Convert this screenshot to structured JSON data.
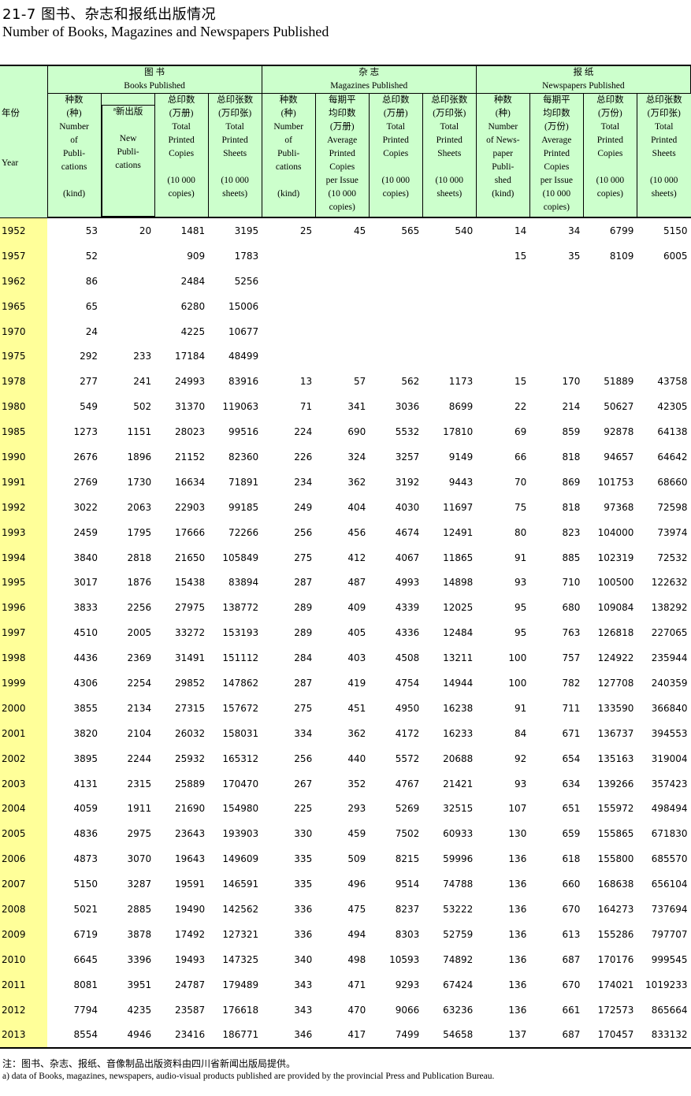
{
  "title_cn": "21-7  图书、杂志和报纸出版情况",
  "title_en": "Number of Books, Magazines and Newspapers Published",
  "year_header": {
    "cn": "年份",
    "en": "Year"
  },
  "groups": [
    {
      "cn": "图  书",
      "en": "Books Published"
    },
    {
      "cn": "杂  志",
      "en": "Magazines Published"
    },
    {
      "cn": "报  纸",
      "en": "Newspapers Published"
    }
  ],
  "columns": [
    {
      "top": "种数",
      "lines": [
        "(种)",
        "Number",
        "of",
        "Publi-",
        "cations",
        "",
        "(kind)"
      ]
    },
    {
      "top": "ª新出版",
      "lines": [
        "New",
        "Publi-",
        "cations"
      ]
    },
    {
      "top": "总印数",
      "lines": [
        "(万册)",
        "Total",
        "Printed",
        "Copies",
        "",
        "(10 000",
        "copies)"
      ]
    },
    {
      "top": "总印张数",
      "lines": [
        "(万印张)",
        "Total",
        "Printed",
        "Sheets",
        "",
        "(10 000",
        "sheets)"
      ]
    },
    {
      "top": "种数",
      "lines": [
        "(种)",
        "Number",
        "of",
        "Publi-",
        "cations",
        "",
        "(kind)"
      ]
    },
    {
      "top": "每期平",
      "lines": [
        "均印数",
        "(万册)",
        "Average",
        "Printed",
        "Copies",
        "per Issue",
        "(10 000",
        "copies)"
      ]
    },
    {
      "top": "总印数",
      "lines": [
        "(万册)",
        "Total",
        "Printed",
        "Copies",
        "",
        "(10 000",
        "copies)"
      ]
    },
    {
      "top": "总印张数",
      "lines": [
        "(万印张)",
        "Total",
        "Printed",
        "Sheets",
        "",
        "(10 000",
        "sheets)"
      ]
    },
    {
      "top": "种数",
      "lines": [
        "(种)",
        "Number",
        "of News-",
        "paper",
        "Publi-",
        "shed",
        "(kind)"
      ]
    },
    {
      "top": "每期平",
      "lines": [
        "均印数",
        "(万份)",
        "Average",
        "Printed",
        "Copies",
        "per Issue",
        "(10 000",
        "copies)"
      ]
    },
    {
      "top": "总印数",
      "lines": [
        "(万份)",
        "Total",
        "Printed",
        "Copies",
        "",
        "(10 000",
        "copies)"
      ]
    },
    {
      "top": "总印张数",
      "lines": [
        "(万印张)",
        "Total",
        "Printed",
        "Sheets",
        "",
        "(10 000",
        "sheets)"
      ]
    }
  ],
  "rows": [
    [
      "1952",
      "53",
      "20",
      "1481",
      "3195",
      "25",
      "45",
      "565",
      "540",
      "14",
      "34",
      "6799",
      "5150"
    ],
    [
      "1957",
      "52",
      "",
      "909",
      "1783",
      "",
      "",
      "",
      "",
      "15",
      "35",
      "8109",
      "6005"
    ],
    [
      "1962",
      "86",
      "",
      "2484",
      "5256",
      "",
      "",
      "",
      "",
      "",
      "",
      "",
      ""
    ],
    [
      "1965",
      "65",
      "",
      "6280",
      "15006",
      "",
      "",
      "",
      "",
      "",
      "",
      "",
      ""
    ],
    [
      "1970",
      "24",
      "",
      "4225",
      "10677",
      "",
      "",
      "",
      "",
      "",
      "",
      "",
      ""
    ],
    [
      "1975",
      "292",
      "233",
      "17184",
      "48499",
      "",
      "",
      "",
      "",
      "",
      "",
      "",
      ""
    ],
    [
      "1978",
      "277",
      "241",
      "24993",
      "83916",
      "13",
      "57",
      "562",
      "1173",
      "15",
      "170",
      "51889",
      "43758"
    ],
    [
      "1980",
      "549",
      "502",
      "31370",
      "119063",
      "71",
      "341",
      "3036",
      "8699",
      "22",
      "214",
      "50627",
      "42305"
    ],
    [
      "1985",
      "1273",
      "1151",
      "28023",
      "99516",
      "224",
      "690",
      "5532",
      "17810",
      "69",
      "859",
      "92878",
      "64138"
    ],
    [
      "1990",
      "2676",
      "1896",
      "21152",
      "82360",
      "226",
      "324",
      "3257",
      "9149",
      "66",
      "818",
      "94657",
      "64642"
    ],
    [
      "1991",
      "2769",
      "1730",
      "16634",
      "71891",
      "234",
      "362",
      "3192",
      "9443",
      "70",
      "869",
      "101753",
      "68660"
    ],
    [
      "1992",
      "3022",
      "2063",
      "22903",
      "99185",
      "249",
      "404",
      "4030",
      "11697",
      "75",
      "818",
      "97368",
      "72598"
    ],
    [
      "1993",
      "2459",
      "1795",
      "17666",
      "72266",
      "256",
      "456",
      "4674",
      "12491",
      "80",
      "823",
      "104000",
      "73974"
    ],
    [
      "1994",
      "3840",
      "2818",
      "21650",
      "105849",
      "275",
      "412",
      "4067",
      "11865",
      "91",
      "885",
      "102319",
      "72532"
    ],
    [
      "1995",
      "3017",
      "1876",
      "15438",
      "83894",
      "287",
      "487",
      "4993",
      "14898",
      "93",
      "710",
      "100500",
      "122632"
    ],
    [
      "1996",
      "3833",
      "2256",
      "27975",
      "138772",
      "289",
      "409",
      "4339",
      "12025",
      "95",
      "680",
      "109084",
      "138292"
    ],
    [
      "1997",
      "4510",
      "2005",
      "33272",
      "153193",
      "289",
      "405",
      "4336",
      "12484",
      "95",
      "763",
      "126818",
      "227065"
    ],
    [
      "1998",
      "4436",
      "2369",
      "31491",
      "151112",
      "284",
      "403",
      "4508",
      "13211",
      "100",
      "757",
      "124922",
      "235944"
    ],
    [
      "1999",
      "4306",
      "2254",
      "29852",
      "147862",
      "287",
      "419",
      "4754",
      "14944",
      "100",
      "782",
      "127708",
      "240359"
    ],
    [
      "2000",
      "3855",
      "2134",
      "27315",
      "157672",
      "275",
      "451",
      "4950",
      "16238",
      "91",
      "711",
      "133590",
      "366840"
    ],
    [
      "2001",
      "3820",
      "2104",
      "26032",
      "158031",
      "334",
      "362",
      "4172",
      "16233",
      "84",
      "671",
      "136737",
      "394553"
    ],
    [
      "2002",
      "3895",
      "2244",
      "25932",
      "165312",
      "256",
      "440",
      "5572",
      "20688",
      "92",
      "654",
      "135163",
      "319004"
    ],
    [
      "2003",
      "4131",
      "2315",
      "25889",
      "170470",
      "267",
      "352",
      "4767",
      "21421",
      "93",
      "634",
      "139266",
      "357423"
    ],
    [
      "2004",
      "4059",
      "1911",
      "21690",
      "154980",
      "225",
      "293",
      "5269",
      "32515",
      "107",
      "651",
      "155972",
      "498494"
    ],
    [
      "2005",
      "4836",
      "2975",
      "23643",
      "193903",
      "330",
      "459",
      "7502",
      "60933",
      "130",
      "659",
      "155865",
      "671830"
    ],
    [
      "2006",
      "4873",
      "3070",
      "19643",
      "149609",
      "335",
      "509",
      "8215",
      "59996",
      "136",
      "618",
      "155800",
      "685570"
    ],
    [
      "2007",
      "5150",
      "3287",
      "19591",
      "146591",
      "335",
      "496",
      "9514",
      "74788",
      "136",
      "660",
      "168638",
      "656104"
    ],
    [
      "2008",
      "5021",
      "2885",
      "19490",
      "142562",
      "336",
      "475",
      "8237",
      "53222",
      "136",
      "670",
      "164273",
      "737694"
    ],
    [
      "2009",
      "6719",
      "3878",
      "17492",
      "127321",
      "336",
      "494",
      "8303",
      "52759",
      "136",
      "613",
      "155286",
      "797707"
    ],
    [
      "2010",
      "6645",
      "3396",
      "19493",
      "147325",
      "340",
      "498",
      "10593",
      "74892",
      "136",
      "687",
      "170176",
      "999545"
    ],
    [
      "2011",
      "8081",
      "3951",
      "24787",
      "179489",
      "343",
      "471",
      "9293",
      "67424",
      "136",
      "670",
      "174021",
      "1019233"
    ],
    [
      "2012",
      "7794",
      "4235",
      "23587",
      "176618",
      "343",
      "470",
      "9066",
      "63236",
      "136",
      "661",
      "172573",
      "865664"
    ],
    [
      "2013",
      "8554",
      "4946",
      "23416",
      "186771",
      "346",
      "417",
      "7499",
      "54658",
      "137",
      "687",
      "170457",
      "833132"
    ]
  ],
  "footnote_cn": "注：图书、杂志、报纸、音像制品出版资料由四川省新闻出版局提供。",
  "footnote_en": "a) data of Books, magazines, newspapers, audio-visual products published  are provided by the provincial Press and Publication Bureau."
}
